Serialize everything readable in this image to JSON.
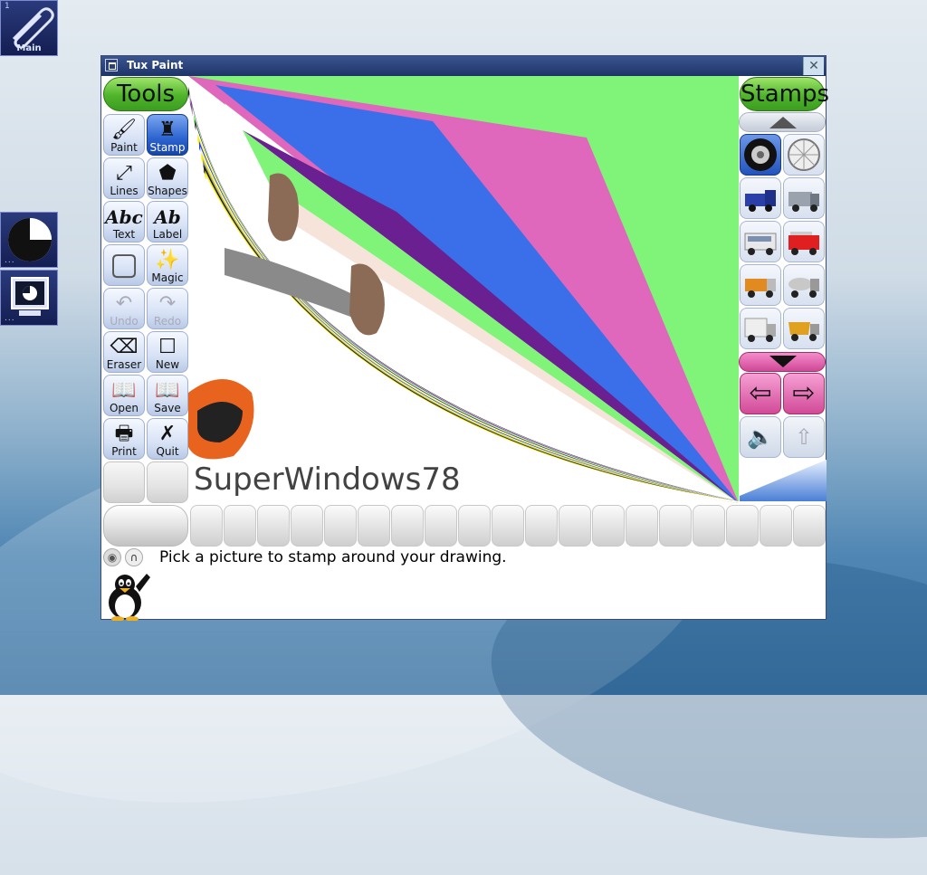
{
  "desktop": {
    "main_icon": {
      "workspace": "1",
      "label": "Main"
    },
    "icons": [
      {
        "name": "pie-chart-icon"
      },
      {
        "name": "monitor-icon"
      }
    ]
  },
  "window": {
    "title": "Tux Paint",
    "close_glyph": "✕"
  },
  "tools": {
    "header": "Tools",
    "items": [
      {
        "label": "Paint",
        "icon": "🖌",
        "name": "paint"
      },
      {
        "label": "Stamp",
        "icon": "♜",
        "name": "stamp",
        "selected": true
      },
      {
        "label": "Lines",
        "icon": "⤢",
        "name": "lines"
      },
      {
        "label": "Shapes",
        "icon": "⬟",
        "name": "shapes"
      },
      {
        "label": "Text",
        "icon": "Abc",
        "name": "text"
      },
      {
        "label": "Label",
        "icon": "Ab",
        "name": "label"
      },
      {
        "label": "",
        "icon": "▢",
        "name": "fill"
      },
      {
        "label": "Magic",
        "icon": "✨",
        "name": "magic"
      },
      {
        "label": "Undo",
        "icon": "↶",
        "name": "undo",
        "disabled": true
      },
      {
        "label": "Redo",
        "icon": "↷",
        "name": "redo",
        "disabled": true
      },
      {
        "label": "Eraser",
        "icon": "⌫",
        "name": "eraser"
      },
      {
        "label": "New",
        "icon": "☐",
        "name": "new"
      },
      {
        "label": "Open",
        "icon": "📖",
        "name": "open"
      },
      {
        "label": "Save",
        "icon": "📖",
        "name": "save"
      },
      {
        "label": "Print",
        "icon": "🖶",
        "name": "print"
      },
      {
        "label": "Quit",
        "icon": "✗",
        "name": "quit"
      }
    ]
  },
  "stamps": {
    "header": "Stamps",
    "left_arrow": "⇦",
    "right_arrow": "⇨",
    "sound_glyph": "🔈",
    "up_glyph": "⇧"
  },
  "canvas": {
    "watermark": "SuperWindows78",
    "colors": {
      "green": "#80f478",
      "pink": "#df68bd",
      "blue": "#3a6fe9",
      "purple": "#6a2090",
      "cream": "#f6e4da",
      "yellow": "#f2ec10",
      "orange": "#e8641e"
    }
  },
  "info": {
    "message": "Pick a picture to stamp around your drawing."
  }
}
